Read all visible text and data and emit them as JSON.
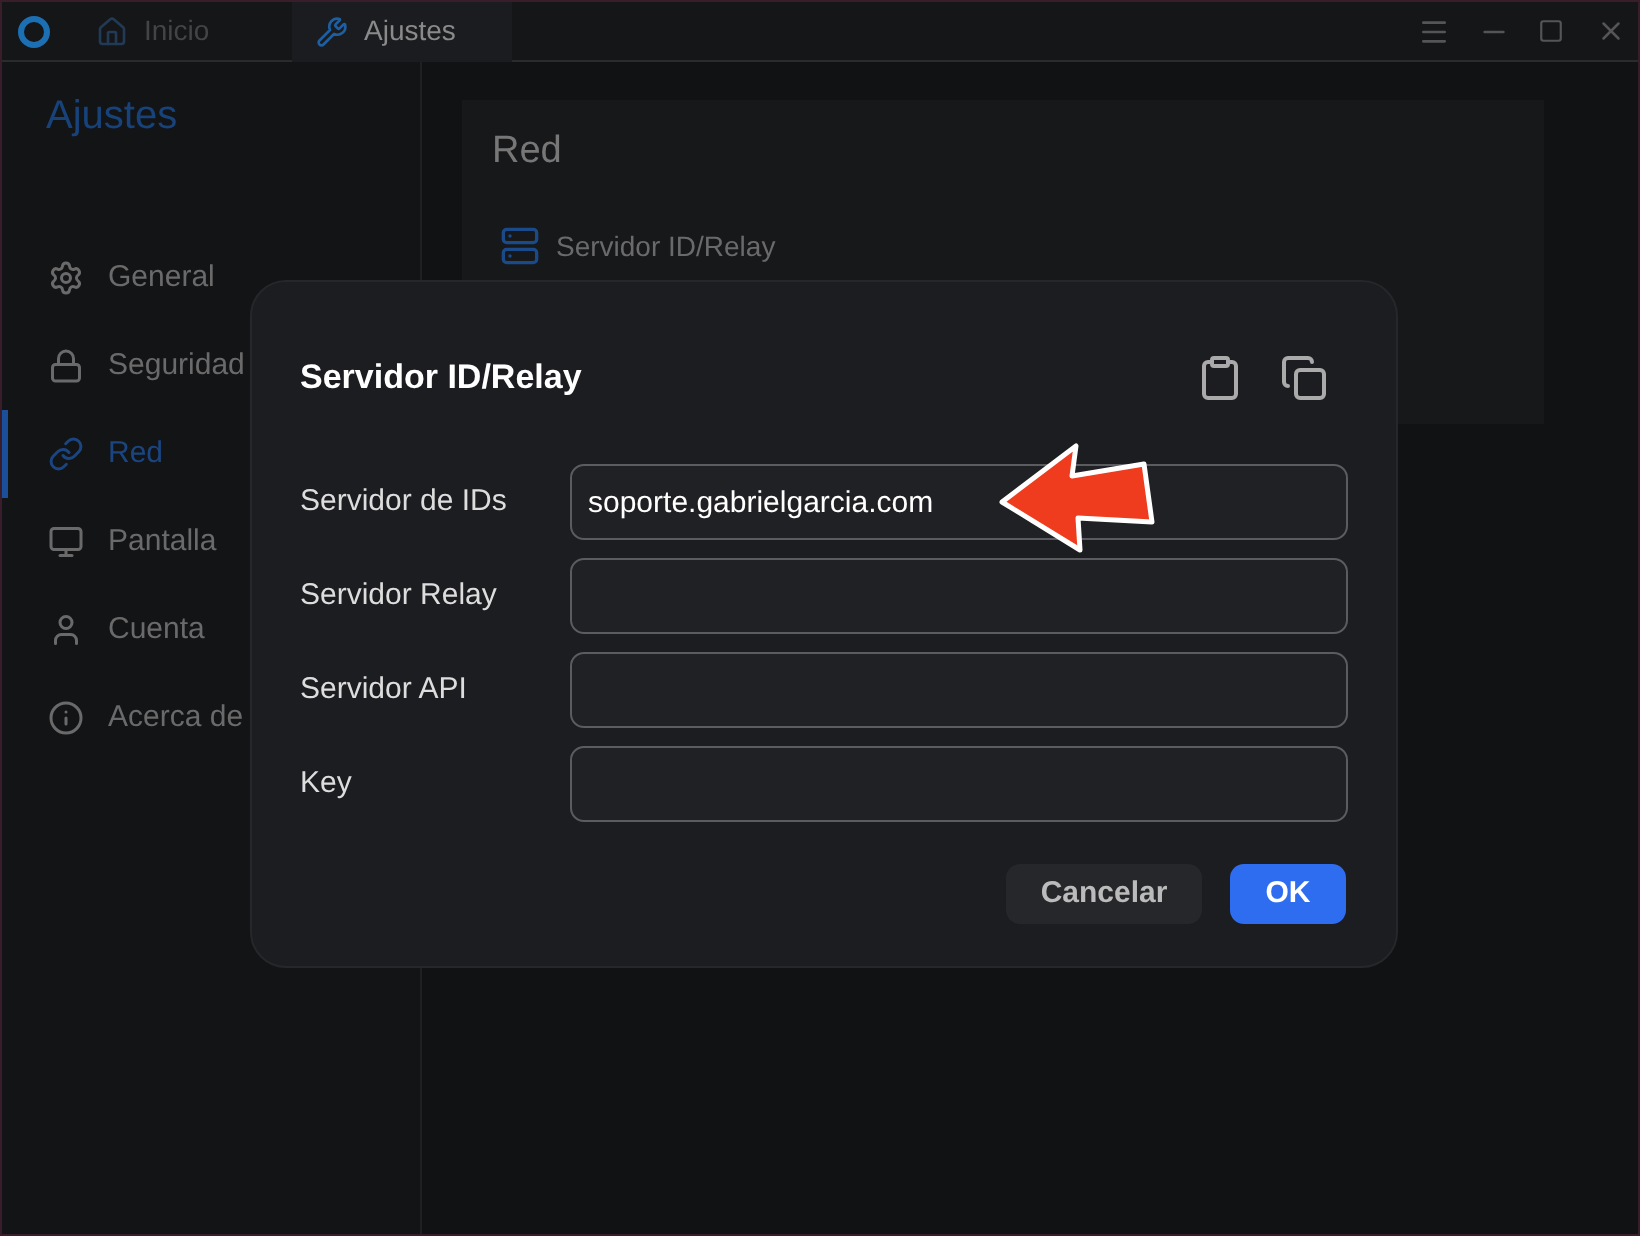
{
  "window": {
    "tabs": [
      {
        "label": "Inicio",
        "kind": "home",
        "selected": false
      },
      {
        "label": "Ajustes",
        "kind": "wrench",
        "selected": true
      }
    ]
  },
  "sidebar": {
    "title": "Ajustes",
    "items": [
      {
        "label": "General",
        "kind": "gear",
        "selected": false
      },
      {
        "label": "Seguridad",
        "kind": "lock",
        "selected": false
      },
      {
        "label": "Red",
        "kind": "link",
        "selected": true
      },
      {
        "label": "Pantalla",
        "kind": "monitor",
        "selected": false
      },
      {
        "label": "Cuenta",
        "kind": "user",
        "selected": false
      },
      {
        "label": "Acerca de",
        "kind": "info",
        "selected": false
      }
    ]
  },
  "content": {
    "title": "Red",
    "items": [
      {
        "label": "Servidor ID/Relay"
      }
    ]
  },
  "dialog": {
    "title": "Servidor ID/Relay",
    "fields": [
      {
        "label": "Servidor de IDs",
        "value": "soporte.gabrielgarcia.com"
      },
      {
        "label": "Servidor Relay"
      },
      {
        "label": "Servidor API"
      },
      {
        "label": "Key"
      }
    ],
    "buttons": [
      {
        "label": "Cancelar",
        "kind": "secondary"
      },
      {
        "label": "OK",
        "kind": "primary"
      }
    ]
  }
}
